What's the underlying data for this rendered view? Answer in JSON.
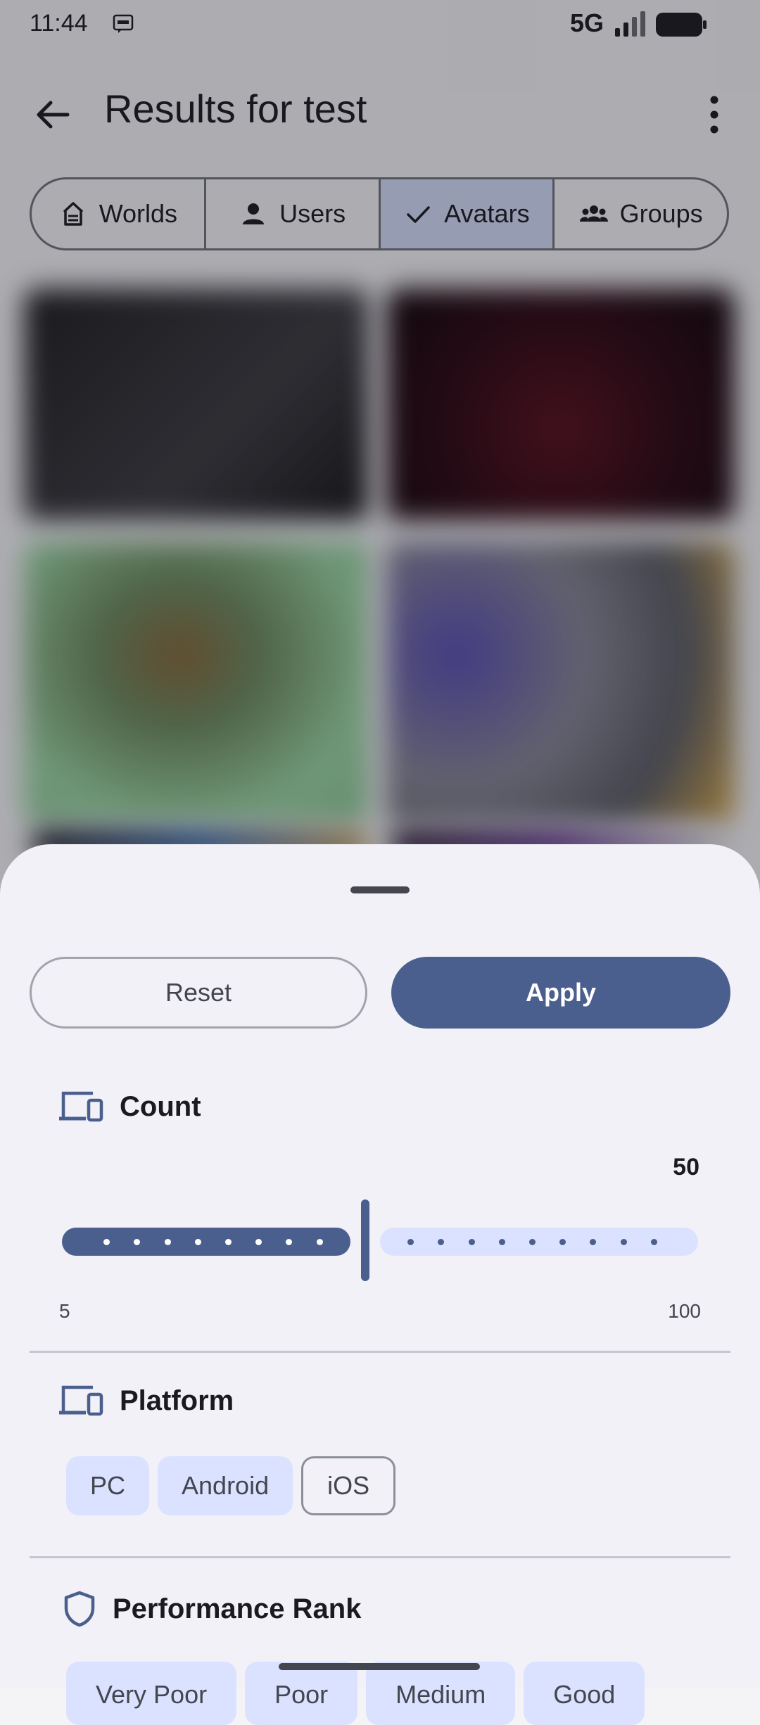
{
  "status_bar": {
    "time": "11:44",
    "network": "5G"
  },
  "header": {
    "title": "Results for test"
  },
  "tabs": [
    {
      "label": "Worlds",
      "icon": "world-icon",
      "selected": false
    },
    {
      "label": "Users",
      "icon": "person-icon",
      "selected": false
    },
    {
      "label": "Avatars",
      "icon": "check-icon",
      "selected": true
    },
    {
      "label": "Groups",
      "icon": "groups-icon",
      "selected": false
    }
  ],
  "filter_sheet": {
    "reset_label": "Reset",
    "apply_label": "Apply",
    "count": {
      "title": "Count",
      "value": "50",
      "min": "5",
      "max": "100",
      "fraction": 0.47
    },
    "platform": {
      "title": "Platform",
      "options": [
        {
          "label": "PC",
          "selected": true
        },
        {
          "label": "Android",
          "selected": true
        },
        {
          "label": "iOS",
          "selected": false
        }
      ]
    },
    "performance_rank": {
      "title": "Performance Rank",
      "options": [
        "Very Poor",
        "Poor",
        "Medium",
        "Good"
      ]
    }
  },
  "colors": {
    "primary": "#4b5f8f",
    "primary_container": "#dae2ff",
    "sheet_bg": "#f1f1f7"
  }
}
